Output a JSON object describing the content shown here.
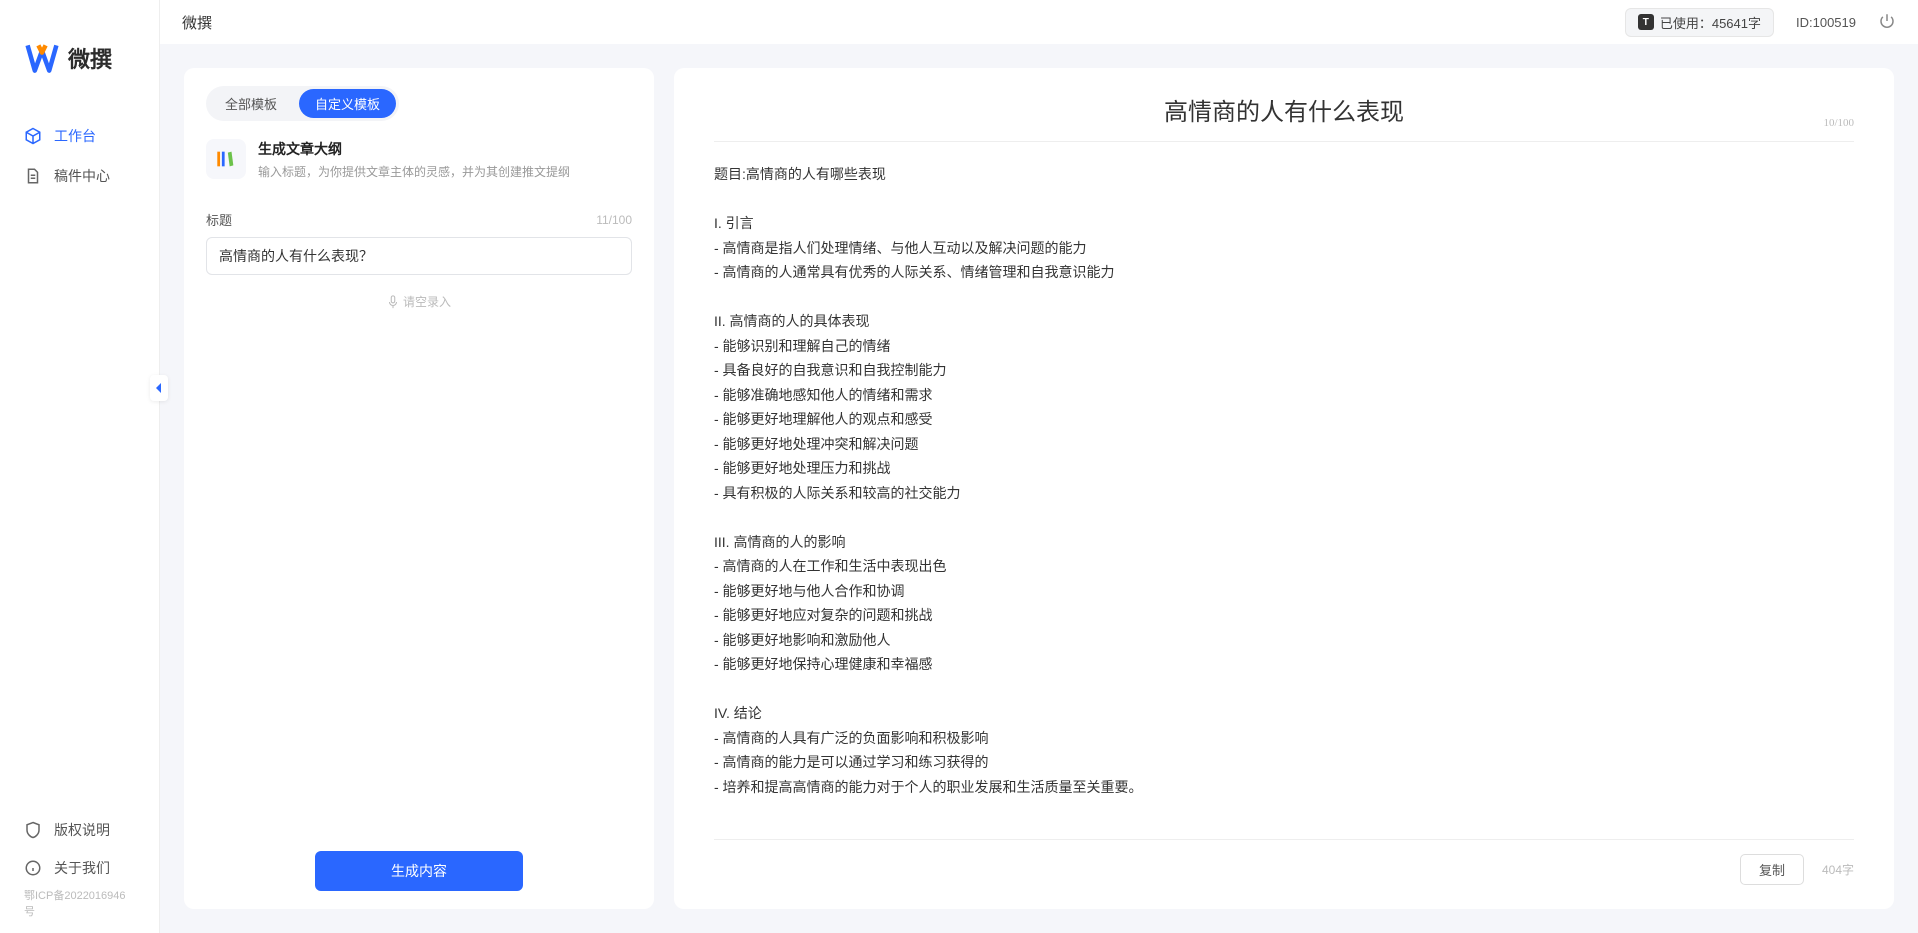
{
  "app": {
    "name": "微撰",
    "topbar_title": "微撰"
  },
  "topbar": {
    "usage_label": "已使用：45641字",
    "id_label": "ID:100519"
  },
  "sidebar": {
    "nav": [
      {
        "label": "工作台",
        "icon": "cube-icon",
        "active": true
      },
      {
        "label": "稿件中心",
        "icon": "document-icon",
        "active": false
      }
    ],
    "footer": [
      {
        "label": "版权说明",
        "icon": "shield-icon"
      },
      {
        "label": "关于我们",
        "icon": "info-icon"
      }
    ],
    "icp": "鄂ICP备2022016946号"
  },
  "left_panel": {
    "tabs": [
      {
        "label": "全部模板",
        "active": false
      },
      {
        "label": "自定义模板",
        "active": true
      }
    ],
    "template": {
      "name": "生成文章大纲",
      "desc": "输入标题，为你提供文章主体的灵感，并为其创建推文提纲"
    },
    "title_form": {
      "label": "标题",
      "count": "11/100",
      "value": "高情商的人有什么表现？"
    },
    "voice_hint": "请空录入",
    "generate_label": "生成内容"
  },
  "right_panel": {
    "title": "高情商的人有什么表现",
    "io_count": "10/100",
    "content": "题目:高情商的人有哪些表现\n\nI. 引言\n- 高情商是指人们处理情绪、与他人互动以及解决问题的能力\n- 高情商的人通常具有优秀的人际关系、情绪管理和自我意识能力\n\nII. 高情商的人的具体表现\n- 能够识别和理解自己的情绪\n- 具备良好的自我意识和自我控制能力\n- 能够准确地感知他人的情绪和需求\n- 能够更好地理解他人的观点和感受\n- 能够更好地处理冲突和解决问题\n- 能够更好地处理压力和挑战\n- 具有积极的人际关系和较高的社交能力\n\nIII. 高情商的人的影响\n- 高情商的人在工作和生活中表现出色\n- 能够更好地与他人合作和协调\n- 能够更好地应对复杂的问题和挑战\n- 能够更好地影响和激励他人\n- 能够更好地保持心理健康和幸福感\n\nIV. 结论\n- 高情商的人具有广泛的负面影响和积极影响\n- 高情商的能力是可以通过学习和练习获得的\n- 培养和提高高情商的能力对于个人的职业发展和生活质量至关重要。",
    "copy_label": "复制",
    "word_count": "404字"
  }
}
